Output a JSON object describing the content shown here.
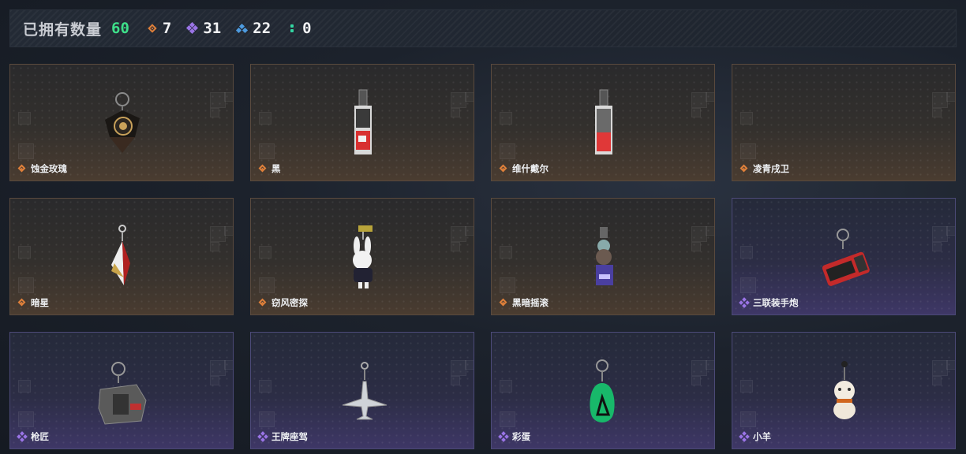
{
  "summary": {
    "title": "已拥有数量",
    "total": "60",
    "stats": [
      {
        "icon": "orange-diamond-icon",
        "value": "7",
        "color": "#e0803a"
      },
      {
        "icon": "purple-diamond-icon",
        "value": "31",
        "color": "#9a74e6"
      },
      {
        "icon": "blue-diamond-icon",
        "value": "22",
        "color": "#4d9be0"
      },
      {
        "icon": "green-dots-icon",
        "value": "0",
        "color": "#33d6a2"
      }
    ]
  },
  "items": [
    {
      "name": "蚀金玫瑰",
      "rarity": "orange",
      "icon": "black-gold-rose-charm"
    },
    {
      "name": "黑",
      "rarity": "orange",
      "icon": "black-card-charm"
    },
    {
      "name": "维什戴尔",
      "rarity": "orange",
      "icon": "red-card-charm"
    },
    {
      "name": "凌青戌卫",
      "rarity": "orange",
      "icon": "empty"
    },
    {
      "name": "暗星",
      "rarity": "orange",
      "icon": "dark-star-feather-charm"
    },
    {
      "name": "窃风密探",
      "rarity": "orange",
      "icon": "bunny-figure-charm"
    },
    {
      "name": "黑暗摇滚",
      "rarity": "orange",
      "icon": "rocker-figure-charm"
    },
    {
      "name": "三联装手炮",
      "rarity": "purple",
      "icon": "red-hand-cannon-charm"
    },
    {
      "name": "枪匠",
      "rarity": "purple",
      "icon": "metal-plate-charm"
    },
    {
      "name": "王牌座驾",
      "rarity": "purple",
      "icon": "fighter-jet-charm"
    },
    {
      "name": "彩蛋",
      "rarity": "purple",
      "icon": "green-egg-charm"
    },
    {
      "name": "小羊",
      "rarity": "purple",
      "icon": "lamb-figure-charm"
    }
  ]
}
